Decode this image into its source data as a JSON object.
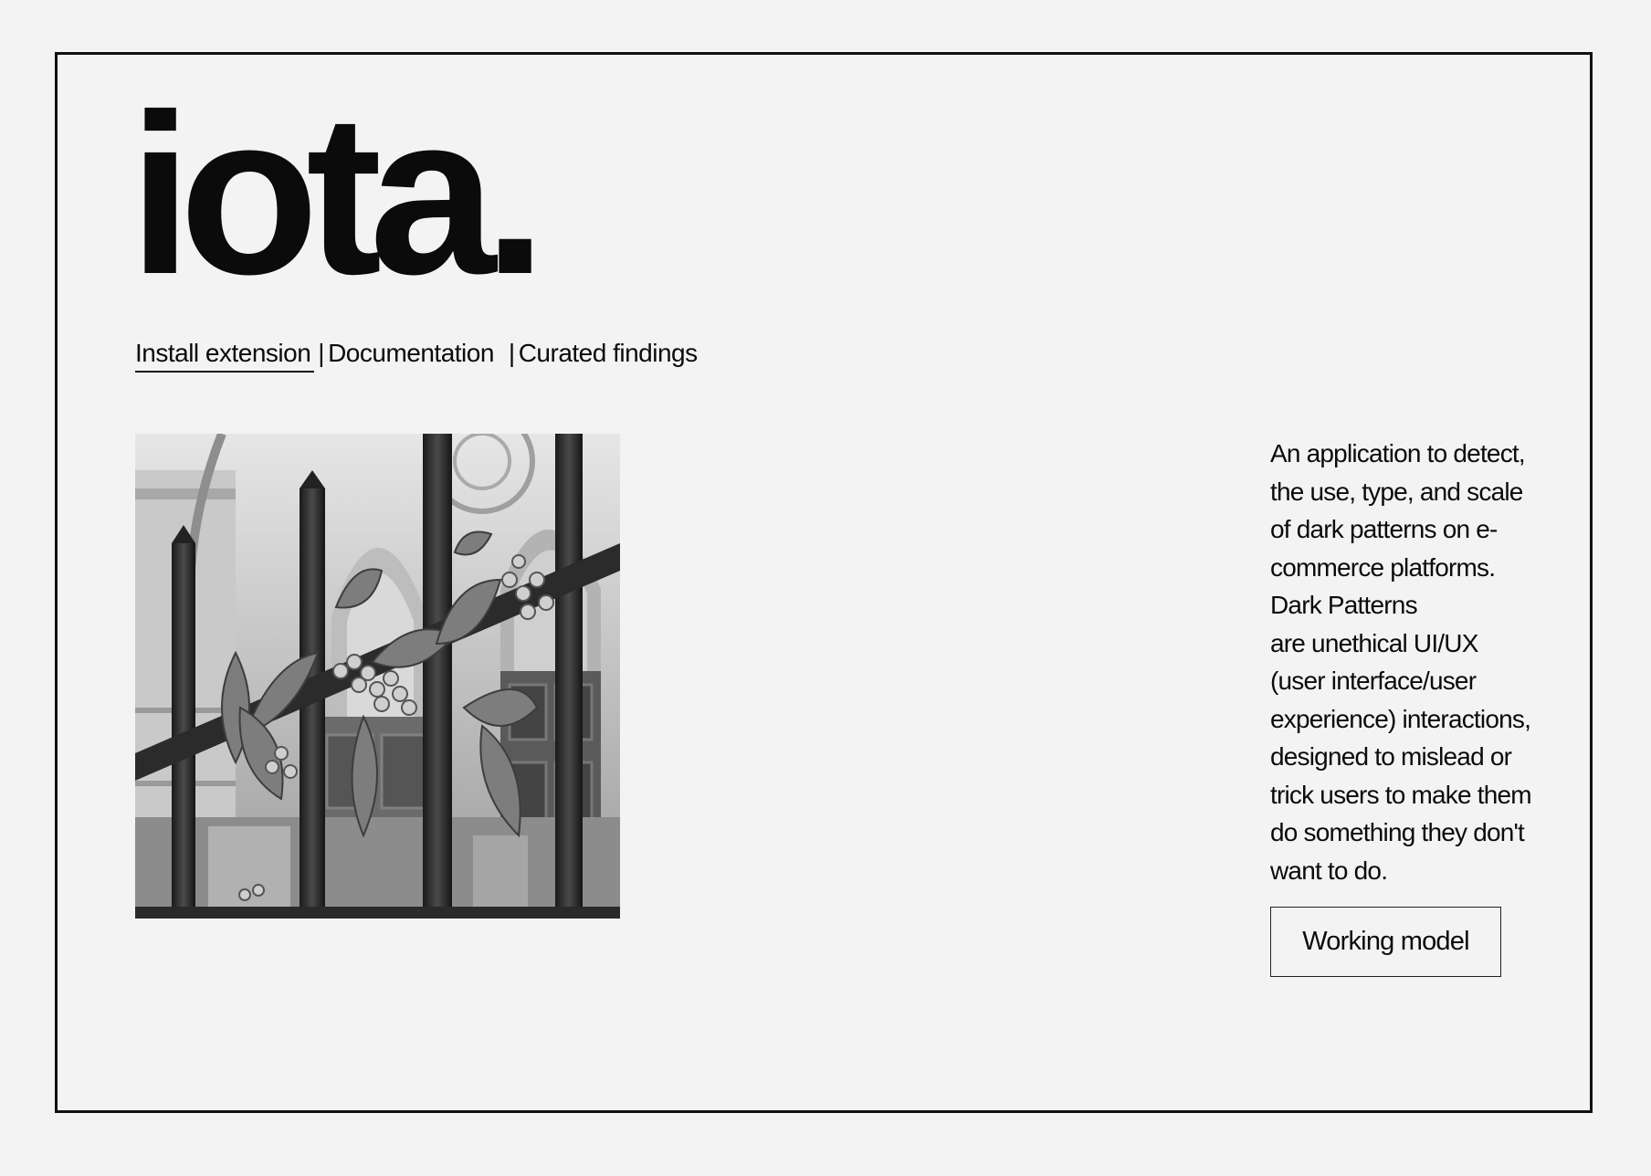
{
  "brand": {
    "logo_text": "iota."
  },
  "nav": {
    "items": [
      {
        "label": "Install extension"
      },
      {
        "label": "Documentation"
      },
      {
        "label": "Curated findings"
      }
    ],
    "separator": "|"
  },
  "hero_image": {
    "icon": "photo-iron-fence-with-vine-leaves-berries"
  },
  "description": {
    "lines": [
      "An application to detect,",
      "the use, type, and scale",
      "of dark patterns on e-",
      "commerce platforms.",
      "Dark Patterns",
      "are unethical UI/UX",
      "(user interface/user",
      "experience) interactions,",
      "designed to mislead or",
      "trick users to make them",
      "do something they don't",
      "want to do."
    ]
  },
  "cta": {
    "label": "Working model"
  },
  "colors": {
    "background": "#f3f3f3",
    "text": "#0b0b0b",
    "border": "#111111"
  }
}
